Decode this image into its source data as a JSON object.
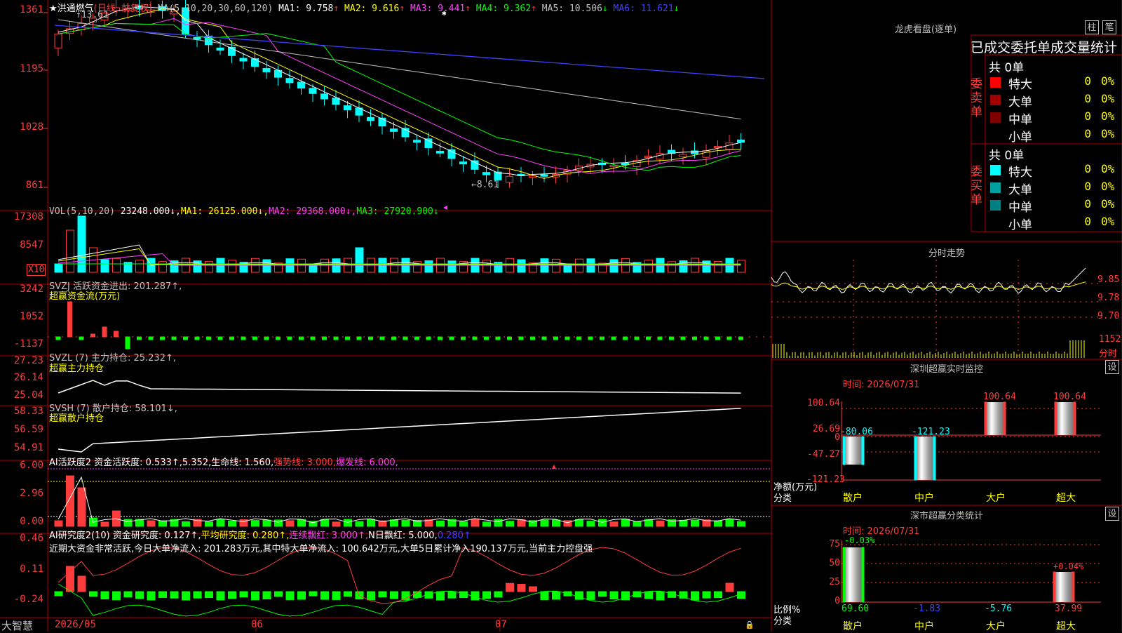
{
  "main": {
    "title": "★洪通燃气",
    "period": "(日线, 前复权)",
    "ma_label": "MA(5,10,20,30,60,120)",
    "ma": [
      {
        "label": "MA1:",
        "value": "9.758",
        "arrow": "↑",
        "color": "#ffffff"
      },
      {
        "label": "MA2:",
        "value": "9.616",
        "arrow": "↑",
        "color": "#ffff00"
      },
      {
        "label": "MA3:",
        "value": "9.441",
        "arrow": "↑",
        "color": "#ff40ff"
      },
      {
        "label": "MA4:",
        "value": "9.362",
        "arrow": "↑",
        "color": "#00ff00"
      },
      {
        "label": "MA5:",
        "value": "10.506",
        "arrow": "↓",
        "color": "#c0c0c0"
      },
      {
        "label": "MA6:",
        "value": "11.621",
        "arrow": "↓",
        "color": "#4040ff"
      }
    ],
    "y_labels": [
      "1361",
      "1195",
      "1028",
      "861"
    ],
    "high_note": "13.61",
    "low_note": "←8.61",
    "star": "✱"
  },
  "vol": {
    "label": "VOL(5,10,20)",
    "value": "23248.000↓,",
    "ma1": "MA1: 26125.000↓,",
    "ma2": "MA2: 29368.000↓,",
    "ma3": "MA3: 27920.900↓",
    "y_labels": [
      "17308",
      "8547"
    ],
    "unit": "X10"
  },
  "svzj": {
    "label": "SVZJ  活跃资金进出: 201.287↑,",
    "sub": "超赢资金流(万元)",
    "y_labels": [
      "3242",
      "1052",
      "-1137"
    ]
  },
  "svzl": {
    "label": "SVZL (7) 主力持仓: 25.232↑,",
    "sub": "超赢主力持仓",
    "y_labels": [
      "27.23",
      "26.14",
      "25.04"
    ]
  },
  "svsh": {
    "label": "SVSH (7) 散户持仓: 58.101↓,",
    "sub": "超赢散户持仓",
    "y_labels": [
      "58.33",
      "56.59",
      "54.91"
    ]
  },
  "ai1": {
    "label": "AI活跃度2 资金活跃度: 0.533↑,5.352,生命线: 1.560,",
    "strong": "强势线: 3.000,",
    "burst": "爆发线: 6.000,",
    "y_labels": [
      "6.00",
      "2.96",
      "0.00"
    ]
  },
  "ai2": {
    "label": "AI研究度2(10) 资金研究度: 0.127↑,",
    "avg": "平均研究度: 0.280↑,",
    "red": "连续飘红: 3.000↑,",
    "nred": "N日飘红: 5.000,",
    "last": "0.280↑",
    "comment": "近期大资金非常活跃,今日大单净流入: 201.283万元,其中特大单净流入: 100.642万元,大单5日累计净入190.137万元,当前主力控盘强",
    "y_labels": [
      "0.46",
      "0.11",
      "-0.24"
    ]
  },
  "bottom": {
    "brand": "大智慧",
    "dates": [
      "2026/05",
      "06",
      "07"
    ]
  },
  "dragon": {
    "title": "龙虎看盘(逐单)",
    "btn1": "柱",
    "btn2": "笔",
    "header": "已成交委托单成交量统计",
    "buy_label": "委买单",
    "sell_label": "委卖单",
    "buy_total": "共 0单",
    "sell_total": "共 0单",
    "buy_rows": [
      {
        "name": "特大",
        "count": "0",
        "pct": "0%",
        "color": "#ff0000"
      },
      {
        "name": "大单",
        "count": "0",
        "pct": "0%",
        "color": "#a00000"
      },
      {
        "name": "中单",
        "count": "0",
        "pct": "0%",
        "color": "#800000"
      },
      {
        "name": "小单",
        "count": "0",
        "pct": "0%",
        "color": "#000000"
      }
    ],
    "sell_rows": [
      {
        "name": "特大",
        "count": "0",
        "pct": "0%",
        "color": "#00ffff"
      },
      {
        "name": "大单",
        "count": "0",
        "pct": "0%",
        "color": "#00a0a0"
      },
      {
        "name": "中单",
        "count": "0",
        "pct": "0%",
        "color": "#008080"
      },
      {
        "name": "小单",
        "count": "0",
        "pct": "0%",
        "color": "#000000"
      }
    ]
  },
  "intraday": {
    "title": "分时走势",
    "y_labels": [
      "9.85",
      "9.78",
      "9.70"
    ],
    "vol_label": "1152",
    "vol_unit": "分时"
  },
  "monitor": {
    "title": "深圳超赢实时监控",
    "set": "设",
    "time": "时间: 2026/07/31",
    "y_labels": [
      "100.64",
      "26.69",
      "0",
      "-47.27",
      "-121.23"
    ],
    "y_title": "净额(万元)",
    "x_title": "分类",
    "bars": [
      {
        "cat": "散户",
        "value": "-80.06"
      },
      {
        "cat": "中户",
        "value": "-121.23"
      },
      {
        "cat": "大户",
        "value": "100.64"
      },
      {
        "cat": "超大",
        "value": "100.64"
      }
    ]
  },
  "classify": {
    "title": "深市超赢分类统计",
    "set": "设",
    "time": "时间: 2026/07/31",
    "y_labels": [
      "75",
      "50",
      "25",
      "0"
    ],
    "y_title": "比例%",
    "x_title": "分类",
    "top_labels": [
      "-0.03%",
      "+0.04%"
    ],
    "bottom_values": [
      "69.60",
      "-1.83",
      "-5.76",
      "37.99"
    ],
    "cats": [
      "散户",
      "中户",
      "大户",
      "超大"
    ]
  }
}
